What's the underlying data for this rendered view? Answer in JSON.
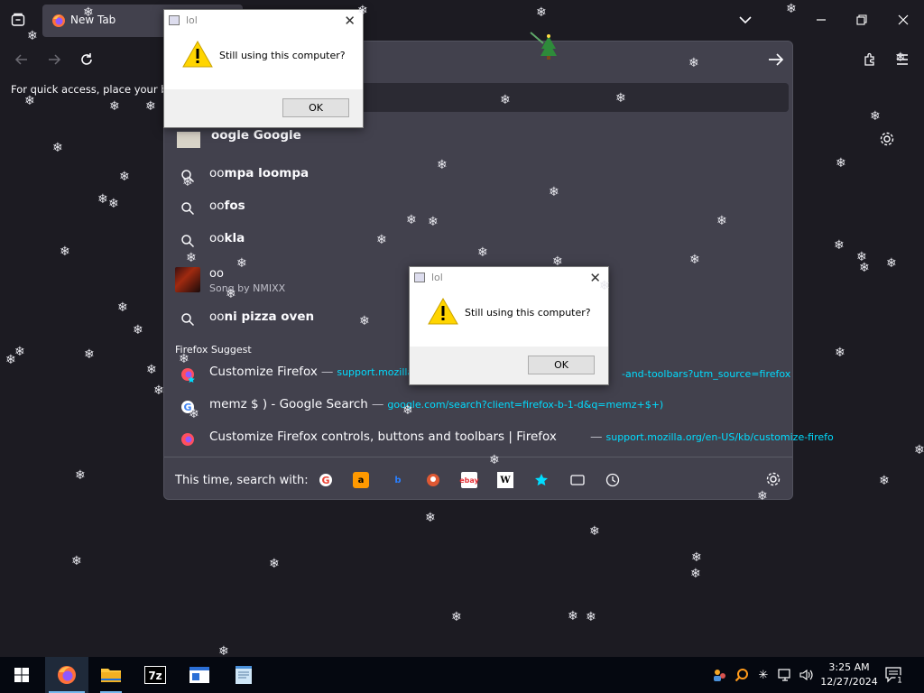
{
  "browser": {
    "tab_title": "New Tab",
    "bookmarks_hint": "For quick access, place your boo"
  },
  "urlbar": {
    "top_result_partial": "oogle Google",
    "suggestions": [
      {
        "kind": "search",
        "typed": "oo",
        "completion": "mpa loompa"
      },
      {
        "kind": "search",
        "typed": "oo",
        "completion": "fos"
      },
      {
        "kind": "search",
        "typed": "oo",
        "completion": "kla"
      },
      {
        "kind": "search",
        "typed": "oo",
        "completion": "ni pizza oven"
      }
    ],
    "song": {
      "title": "oo",
      "subtitle": "Song by NMIXX"
    },
    "section_label": "Firefox Suggest",
    "firefox_suggest": [
      {
        "title": "Customize Firefox",
        "url": "support.mozilla.o",
        "url_tail": "-and-toolbars?utm_source=firefox"
      },
      {
        "title": "memz $ ) - Google Search",
        "url": "google.com/search?client=firefox-b-1-d&q=memz+$+)"
      },
      {
        "title": "Customize Firefox controls, buttons and toolbars | Firefox",
        "url": "support.mozilla.org/en-US/kb/customize-firefo"
      }
    ],
    "search_with_label": "This time, search with:",
    "engines": [
      "google-icon",
      "amazon-icon",
      "bing-icon",
      "duckduckgo-icon",
      "ebay-icon",
      "wikipedia-icon",
      "bookmarks-icon",
      "tabs-icon",
      "history-icon"
    ]
  },
  "dialogs": [
    {
      "title": "lol",
      "message": "Still using this computer?",
      "button": "OK"
    },
    {
      "title": "lol",
      "message": "Still using this computer?",
      "button": "OK"
    }
  ],
  "taskbar": {
    "time": "3:25 AM",
    "date": "12/27/2024",
    "notification_count": "1",
    "pinned": [
      "firefox-icon",
      "file-explorer-icon",
      "7zip-icon",
      "app-window-icon",
      "notepad-icon"
    ]
  },
  "colors": {
    "accent_url": "#00ddff",
    "panel_bg": "#42414d",
    "page_bg": "#1c1b22"
  }
}
